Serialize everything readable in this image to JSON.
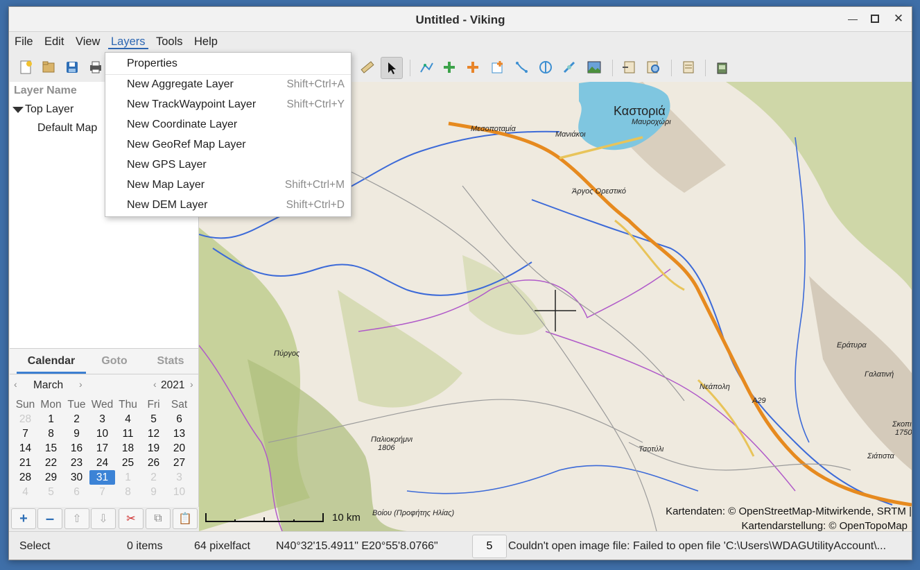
{
  "window": {
    "title": "Untitled - Viking"
  },
  "menubar": {
    "items": [
      "File",
      "Edit",
      "View",
      "Layers",
      "Tools",
      "Help"
    ]
  },
  "layers_menu": {
    "items": [
      {
        "label": "Properties",
        "accel": ""
      },
      {
        "label": "New Aggregate Layer",
        "accel": "Shift+Ctrl+A"
      },
      {
        "label": "New TrackWaypoint Layer",
        "accel": "Shift+Ctrl+Y"
      },
      {
        "label": "New Coordinate Layer",
        "accel": ""
      },
      {
        "label": "New GeoRef Map Layer",
        "accel": ""
      },
      {
        "label": "New GPS Layer",
        "accel": ""
      },
      {
        "label": "New Map Layer",
        "accel": "Shift+Ctrl+M"
      },
      {
        "label": "New DEM Layer",
        "accel": "Shift+Ctrl+D"
      }
    ]
  },
  "layers_panel": {
    "header": "Layer Name",
    "top_layer": "Top Layer",
    "child_layer": "Default Map"
  },
  "calendar": {
    "tabs": [
      "Calendar",
      "Goto",
      "Stats"
    ],
    "month": "March",
    "year": "2021",
    "weekdays": [
      "Sun",
      "Mon",
      "Tue",
      "Wed",
      "Thu",
      "Fri",
      "Sat"
    ],
    "weeks": [
      [
        "28",
        "1",
        "2",
        "3",
        "4",
        "5",
        "6"
      ],
      [
        "7",
        "8",
        "9",
        "10",
        "11",
        "12",
        "13"
      ],
      [
        "14",
        "15",
        "16",
        "17",
        "18",
        "19",
        "20"
      ],
      [
        "21",
        "22",
        "23",
        "24",
        "25",
        "26",
        "27"
      ],
      [
        "28",
        "29",
        "30",
        "31",
        "1",
        "2",
        "3"
      ],
      [
        "4",
        "5",
        "6",
        "7",
        "8",
        "9",
        "10"
      ]
    ],
    "selected_day": "31"
  },
  "map": {
    "labels": {
      "kastoria": "Καστοριά",
      "mavrochori": "Μαυροχώρι",
      "mesopotamia": "Μεσοποταμία",
      "maniakoi": "Μανιάκοι",
      "argos": "Άργος Ορεστικό",
      "pyrgos": "Πύργος",
      "eratyra": "Εράτυρα",
      "galatini": "Γαλατινή",
      "neapoli": "Νεάπολη",
      "paliokrimini": "Παλιοκρήμνι",
      "paliokrimini_elev": "1806",
      "tsotyli": "Τσοτύλι",
      "siatista": "Σιάτιστα",
      "skopia": "Σκοπιά",
      "skopia_elev": "1750",
      "voion": "Βοίου (Προφήτης Ηλίας)",
      "a29": "A29"
    },
    "attribution_line1": "Kartendaten: © OpenStreetMap-Mitwirkende, SRTM |",
    "attribution_line2": "Kartendarstellung: © OpenTopoMap",
    "scale_label": "10 km",
    "colors": {
      "water": "#7fc6e0",
      "road_major": "#e68a1f",
      "road_secondary": "#e8c45a",
      "border": "#b05ac9",
      "river": "#3c6ad8",
      "forest": "#b5c98a"
    }
  },
  "statusbar": {
    "tool": "Select",
    "items": "0 items",
    "zoom_factor": "64 pixelfact",
    "coords": "N40°32'15.4911\" E20°55'8.0766\"",
    "zoom_level": "5",
    "message": "Couldn't open image file: Failed to open file 'C:\\Users\\WDAGUtilityAccount\\..."
  }
}
